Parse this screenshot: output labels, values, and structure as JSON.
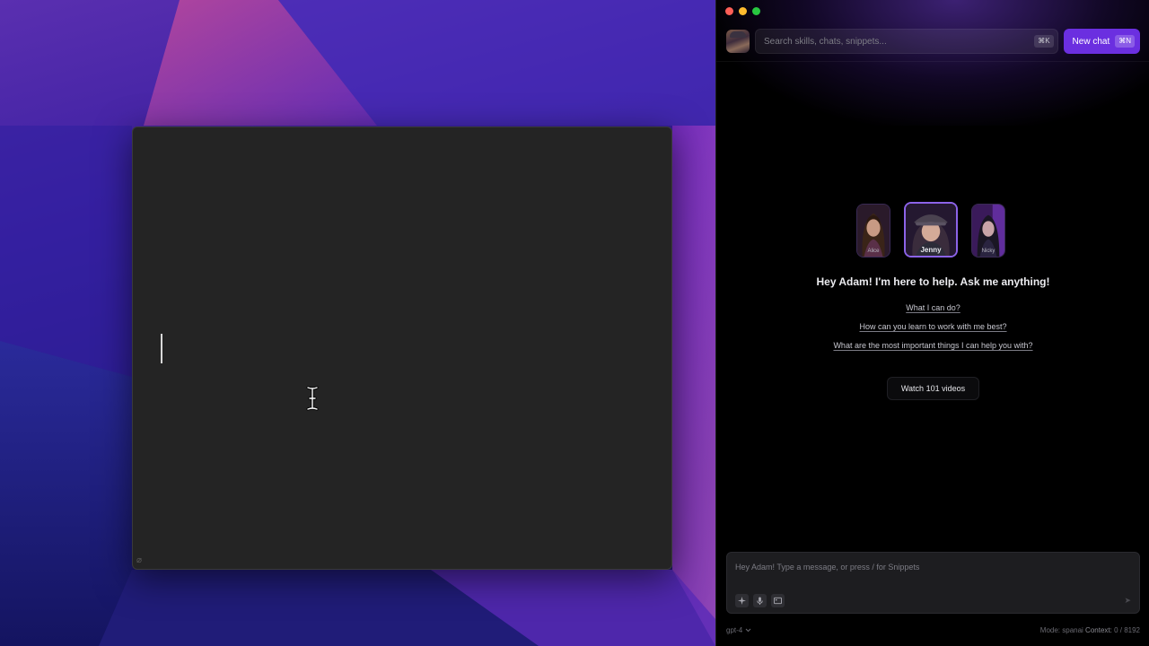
{
  "colors": {
    "accent": "#6b2fe0",
    "panel_bg": "#000000",
    "editor_bg": "#242424",
    "traffic_red": "#fe5f57",
    "traffic_yellow": "#febb2e",
    "traffic_green": "#28c840"
  },
  "topbar": {
    "search_placeholder": "Search skills, chats, snippets...",
    "search_shortcut": "⌘K",
    "new_chat_label": "New chat",
    "new_chat_shortcut": "⌘N"
  },
  "personas": [
    {
      "name": "Alice",
      "selected": false
    },
    {
      "name": "Jenny",
      "selected": true
    },
    {
      "name": "Nicky",
      "selected": false
    }
  ],
  "greeting": "Hey Adam! I'm here to help. Ask me anything!",
  "suggestions": [
    "What I can do?",
    "How can you learn to work with me best?",
    "What are the most important things I can help you with?"
  ],
  "watch_button": "Watch 101 videos",
  "composer": {
    "placeholder": "Hey Adam! Type a message, or press / for Snippets",
    "tools": [
      "sparkle-icon",
      "microphone-icon",
      "image-icon"
    ]
  },
  "status": {
    "model": "gpt-4",
    "mode_label": "Mode: spanai",
    "context_label": "Context:",
    "context_value": "0 / 8192"
  },
  "icons": {
    "model_dropdown": "chevron-down-icon",
    "send": "send-icon",
    "editor_footer": "attach-icon"
  }
}
